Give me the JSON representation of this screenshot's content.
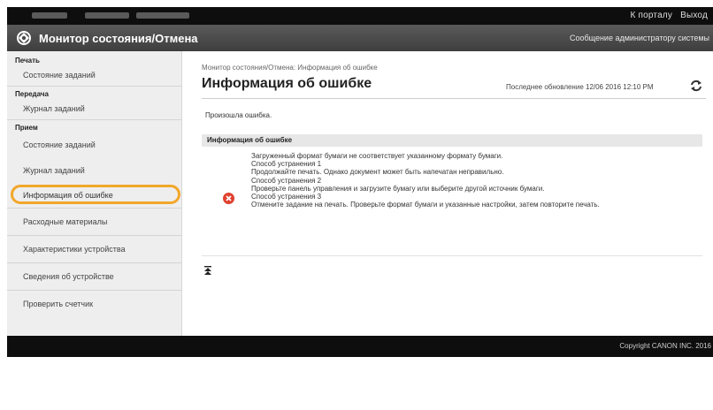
{
  "topbar": {
    "link_portal": "К порталу",
    "link_logout": "Выход"
  },
  "header": {
    "title": "Монитор состояния/Отмена",
    "admin_message": "Сообщение администратору системы"
  },
  "sidebar": {
    "groups": [
      {
        "label": "Печать",
        "items": [
          "Состояние заданий"
        ]
      },
      {
        "label": "Передача",
        "items": [
          "Журнал заданий"
        ]
      },
      {
        "label": "Прием",
        "items": [
          "Состояние заданий",
          "Журнал заданий",
          "Информация об ошибке"
        ]
      }
    ],
    "extra_items": [
      "Расходные материалы",
      "Характеристики устройства",
      "Сведения об устройстве",
      "Проверить счетчик"
    ],
    "active_item": "Информация об ошибке"
  },
  "main": {
    "breadcrumb": "Монитор состояния/Отмена: Информация об ошибке",
    "title": "Информация об ошибке",
    "last_updated": "Последнее обновление 12/06 2016 12:10 PM",
    "occurred": "Произошла ошибка.",
    "section_title": "Информация об ошибке",
    "error_lines": [
      "Загруженный формат бумаги не соответствует указанному формату бумаги.",
      "Способ устранения 1",
      "Продолжайте печать. Однако документ может быть напечатан неправильно.",
      "Способ устранения 2",
      "Проверьте панель управления и загрузите бумагу или выберите другой источник бумаги.",
      "Способ устранения 3",
      "Отмените задание на печать. Проверьте формат бумаги и указанные настройки, затем повторите печать."
    ]
  },
  "footer": {
    "copyright": "Copyright CANON INC. 2016"
  },
  "colors": {
    "highlight": "#f2a72a",
    "error_red": "#e0412f",
    "header_bg": "#4a4a4a"
  },
  "icons": {
    "logo": "canon-logo-icon",
    "refresh": "refresh-icon",
    "error": "error-x-icon",
    "collapse": "collapse-icon"
  }
}
